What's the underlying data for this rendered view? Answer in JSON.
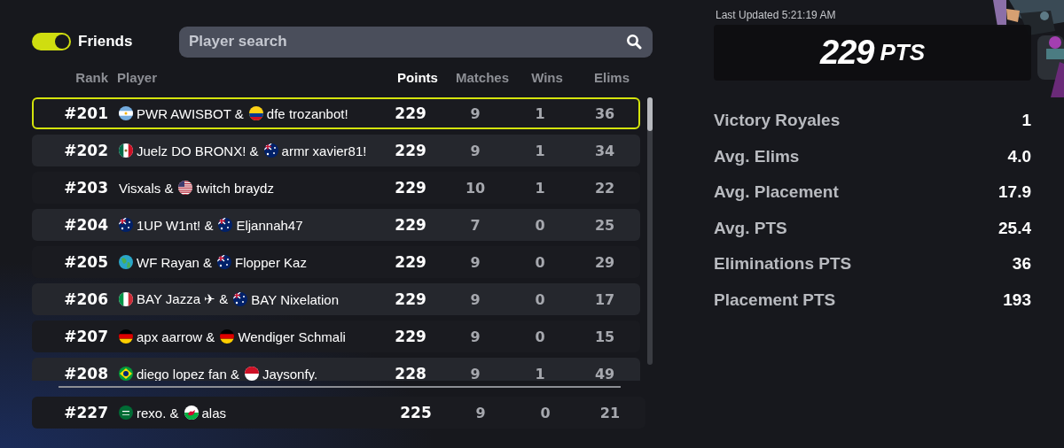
{
  "filter": {
    "label": "Friends",
    "on": true
  },
  "search": {
    "placeholder": "Player search"
  },
  "columns": [
    "Rank",
    "Player",
    "Points",
    "Matches",
    "Wins",
    "Elims"
  ],
  "rows": [
    {
      "rank": "#201",
      "players": [
        {
          "kind": "argentina",
          "name": "PWR AWISBOT &"
        },
        {
          "kind": "colombia",
          "name": "dfe trozanbot!"
        }
      ],
      "points": "229",
      "matches": "9",
      "wins": "1",
      "elims": "36",
      "selected": true
    },
    {
      "rank": "#202",
      "players": [
        {
          "kind": "mexico",
          "name": "Juelz DO BRONX! &"
        },
        {
          "kind": "australia",
          "name": "armr xavier81!"
        }
      ],
      "points": "229",
      "matches": "9",
      "wins": "1",
      "elims": "34",
      "selected": false
    },
    {
      "rank": "#203",
      "players": [
        {
          "name": "Visxals &"
        },
        {
          "kind": "usa",
          "name": "twitch braydz"
        }
      ],
      "points": "229",
      "matches": "10",
      "wins": "1",
      "elims": "22",
      "selected": false
    },
    {
      "rank": "#204",
      "players": [
        {
          "kind": "australia",
          "name": "1UP W1nt! &"
        },
        {
          "kind": "australia",
          "name": "Eljannah47"
        }
      ],
      "points": "229",
      "matches": "7",
      "wins": "0",
      "elims": "25",
      "selected": false
    },
    {
      "rank": "#205",
      "players": [
        {
          "kind": "globe",
          "name": "WF Rayan &"
        },
        {
          "kind": "australia",
          "name": "Flopper Kaz"
        }
      ],
      "points": "229",
      "matches": "9",
      "wins": "0",
      "elims": "29",
      "selected": false
    },
    {
      "rank": "#206",
      "players": [
        {
          "kind": "italy",
          "name": "BAY Jazza ✈ &"
        },
        {
          "kind": "australia",
          "name": "BAY Nixelation"
        }
      ],
      "points": "229",
      "matches": "9",
      "wins": "0",
      "elims": "17",
      "selected": false
    },
    {
      "rank": "#207",
      "players": [
        {
          "kind": "germany",
          "name": "apx aarrow &"
        },
        {
          "kind": "germany",
          "name": "Wendiger Schmali"
        }
      ],
      "points": "229",
      "matches": "9",
      "wins": "0",
      "elims": "15",
      "selected": false
    },
    {
      "rank": "#208",
      "players": [
        {
          "kind": "brazil",
          "name": "diego lopez fan &"
        },
        {
          "kind": "redwhite",
          "name": "Jaysonfy."
        }
      ],
      "points": "228",
      "matches": "9",
      "wins": "1",
      "elims": "49",
      "selected": false
    }
  ],
  "own_row": {
    "rank": "#227",
    "players": [
      {
        "kind": "saudi",
        "name": "rexo. &"
      },
      {
        "kind": "wales",
        "name": "alas"
      }
    ],
    "points": "225",
    "matches": "9",
    "wins": "0",
    "elims": "21",
    "selected": false
  },
  "summary": {
    "last_updated": "Last Updated 5:21:19 AM",
    "points": "229",
    "unit": "PTS"
  },
  "stats": [
    {
      "label": "Victory Royales",
      "value": "1"
    },
    {
      "label": "Avg. Elims",
      "value": "4.0"
    },
    {
      "label": "Avg. Placement",
      "value": "17.9"
    },
    {
      "label": "Avg. PTS",
      "value": "25.4"
    },
    {
      "label": "Eliminations PTS",
      "value": "36"
    },
    {
      "label": "Placement PTS",
      "value": "193"
    }
  ]
}
